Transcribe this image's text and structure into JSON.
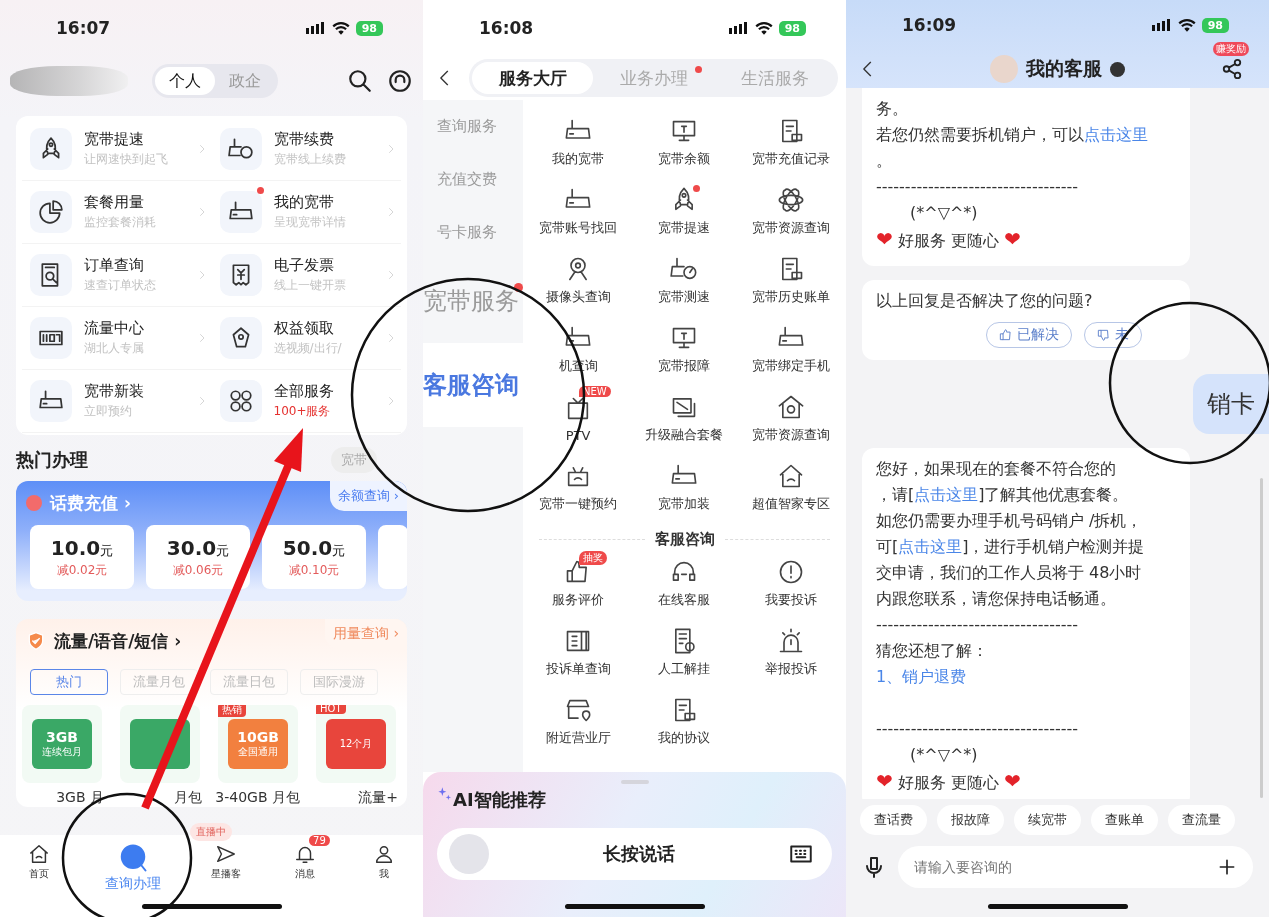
{
  "home_screen": {
    "status_bar": {
      "time": "16:07",
      "battery": "98"
    },
    "account_tabs": [
      {
        "label": "个人",
        "selected": true
      },
      {
        "label": "政企",
        "selected": false
      }
    ],
    "services": [
      {
        "title": "宽带提速",
        "subtitle": "让网速快到起飞"
      },
      {
        "title": "宽带续费",
        "subtitle": "宽带线上续费"
      },
      {
        "title": "套餐用量",
        "subtitle": "监控套餐消耗"
      },
      {
        "title": "我的宽带",
        "subtitle": "呈现宽带详情",
        "dot": true
      },
      {
        "title": "订单查询",
        "subtitle": "速查订单状态"
      },
      {
        "title": "电子发票",
        "subtitle": "线上一键开票"
      },
      {
        "title": "流量中心",
        "subtitle": "湖北人专属"
      },
      {
        "title": "权益领取",
        "subtitle": "选视频/出行/"
      },
      {
        "title": "宽带新装",
        "subtitle": "立即预约"
      },
      {
        "title": "全部服务",
        "subtitle": "100+服务",
        "highlight": true
      }
    ],
    "hot_section": {
      "title": "热门办理",
      "chips": [
        "宽带"
      ]
    },
    "recharge": {
      "title": "话费充值 ›",
      "link": "余额查询 ›",
      "options": [
        {
          "amount": "10.0",
          "unit": "元",
          "discount": "减0.02元"
        },
        {
          "amount": "30.0",
          "unit": "元",
          "discount": "减0.06元"
        },
        {
          "amount": "50.0",
          "unit": "元",
          "discount": "减0.10元"
        }
      ]
    },
    "bundle": {
      "title": "流量/语音/短信 ›",
      "link": "用量查询 ›",
      "filters": [
        {
          "label": "热门",
          "selected": true
        },
        {
          "label": "流量月包",
          "selected": false
        },
        {
          "label": "流量日包",
          "selected": false
        },
        {
          "label": "国际漫游",
          "selected": false
        }
      ],
      "products": [
        {
          "size": "3GB",
          "caption": "连续包月",
          "name": "3GB 月",
          "color": "#3aa866"
        },
        {
          "name": "月包",
          "color": "#3aa866"
        },
        {
          "badge": "热销",
          "size": "10GB",
          "caption": "全国通用",
          "name": "3-40GB 月包",
          "color": "#f2803f"
        },
        {
          "badge": "HOT",
          "caption": "12个月",
          "name": "流量+",
          "color": "#e8453c"
        }
      ]
    },
    "live_badge": "直播中",
    "nav": [
      {
        "label": "首页",
        "selected": false
      },
      {
        "label": "查询办理",
        "selected": true
      },
      {
        "label": "星播客",
        "selected": false
      },
      {
        "label": "消息",
        "selected": false,
        "badge": "79"
      },
      {
        "label": "我",
        "selected": false
      }
    ]
  },
  "service_hall": {
    "status_bar": {
      "time": "16:08",
      "battery": "98"
    },
    "tabs": [
      {
        "label": "服务大厅",
        "selected": true
      },
      {
        "label": "业务办理",
        "selected": false,
        "dot": true
      },
      {
        "label": "生活服务",
        "selected": false
      }
    ],
    "sidebar": [
      {
        "label": "查询服务",
        "selected": false
      },
      {
        "label": "充值交费",
        "selected": false
      },
      {
        "label": "号卡服务",
        "selected": false
      },
      {
        "label": "宽带服务",
        "selected": false,
        "dot": true,
        "zoomed": true
      },
      {
        "label": "客服咨询",
        "selected": true,
        "zoomed": true
      }
    ],
    "broadband_items": [
      {
        "label": "我的宽带"
      },
      {
        "label": "宽带余额"
      },
      {
        "label": "宽带充值记录"
      },
      {
        "label": "宽带账号找回"
      },
      {
        "label": "宽带提速",
        "dot": true
      },
      {
        "label": "宽带资源查询"
      },
      {
        "label": "摄像头查询"
      },
      {
        "label": "宽带测速"
      },
      {
        "label": "宽带历史账单"
      },
      {
        "label": "机查询"
      },
      {
        "label": "宽带报障"
      },
      {
        "label": "宽带绑定手机"
      },
      {
        "label": "PTV",
        "badge": "NEW"
      },
      {
        "label": "升级融合套餐"
      },
      {
        "label": "宽带资源查询"
      },
      {
        "label": "宽带一键预约"
      },
      {
        "label": "宽带加装"
      },
      {
        "label": "超值智家专区"
      }
    ],
    "support_title": "客服咨询",
    "support_items": [
      {
        "label": "服务评价",
        "badge": "抽奖"
      },
      {
        "label": "在线客服"
      },
      {
        "label": "我要投诉"
      },
      {
        "label": "投诉单查询"
      },
      {
        "label": "人工解挂"
      },
      {
        "label": "举报投诉"
      },
      {
        "label": "附近营业厅"
      },
      {
        "label": "我的协议"
      }
    ],
    "ai_panel": {
      "title": "AI智能推荐",
      "voice_button": "长按说话"
    }
  },
  "chat": {
    "status_bar": {
      "time": "16:09",
      "battery": "98"
    },
    "title": "我的客服",
    "share_badge": "赚奖励",
    "messages": [
      {
        "kind": "bot",
        "lines": [
          {
            "parts": [
              {
                "text": "务。"
              }
            ]
          },
          {
            "parts": [
              {
                "text": "若您仍然需要拆机销户，可以"
              },
              {
                "text": "点击这里",
                "link": true
              }
            ]
          },
          {
            "parts": [
              {
                "text": "。"
              }
            ]
          },
          {
            "parts": [
              {
                "text": "-----------------------------------"
              }
            ]
          },
          {
            "indent": true,
            "parts": [
              {
                "text": "(*^▽^*)"
              }
            ]
          },
          {
            "parts": [
              {
                "text": "❤",
                "heart": true
              },
              {
                "text": " 好服务 更随心 "
              },
              {
                "text": "❤",
                "heart": true
              }
            ]
          }
        ]
      },
      {
        "kind": "feedback",
        "lines": [
          {
            "parts": [
              {
                "text": "以上回复是否解决了您的问题?"
              }
            ]
          }
        ],
        "buttons": [
          {
            "label": "已解决"
          },
          {
            "label": "未"
          }
        ]
      },
      {
        "kind": "user",
        "lines": [
          {
            "parts": [
              {
                "text": "销卡"
              }
            ]
          }
        ]
      },
      {
        "kind": "bot",
        "lines": [
          {
            "parts": [
              {
                "text": "您好，如果现在的套餐不符合您的"
              }
            ]
          },
          {
            "parts": [
              {
                "text": "，请["
              },
              {
                "text": "点击这里",
                "link": true
              },
              {
                "text": "]了解其他优惠套餐。"
              }
            ]
          },
          {
            "parts": [
              {
                "text": "如您仍需要办理手机号码销户 /拆机，"
              }
            ]
          },
          {
            "parts": [
              {
                "text": "可["
              },
              {
                "text": "点击这里",
                "link": true
              },
              {
                "text": "]，进行手机销户检测并提"
              }
            ]
          },
          {
            "parts": [
              {
                "text": "交申请，我们的工作人员将于 48小时"
              }
            ]
          },
          {
            "parts": [
              {
                "text": "内跟您联系，请您保持电话畅通。"
              }
            ]
          },
          {
            "parts": [
              {
                "text": "-----------------------------------"
              }
            ]
          },
          {
            "parts": [
              {
                "text": "猜您还想了解："
              }
            ]
          },
          {
            "parts": [
              {
                "text": "1、销户退费",
                "link": true
              }
            ]
          },
          {
            "gap_before": true,
            "parts": [
              {
                "text": "-----------------------------------"
              }
            ]
          },
          {
            "indent": true,
            "parts": [
              {
                "text": "(*^▽^*)"
              }
            ]
          },
          {
            "parts": [
              {
                "text": "❤",
                "heart": true
              },
              {
                "text": " 好服务 更随心 "
              },
              {
                "text": "❤",
                "heart": true
              }
            ]
          }
        ]
      }
    ],
    "quick_replies": [
      "查话费",
      "报故障",
      "续宽带",
      "查账单",
      "查流量"
    ],
    "input": {
      "placeholder": "请输入要咨询的"
    }
  }
}
